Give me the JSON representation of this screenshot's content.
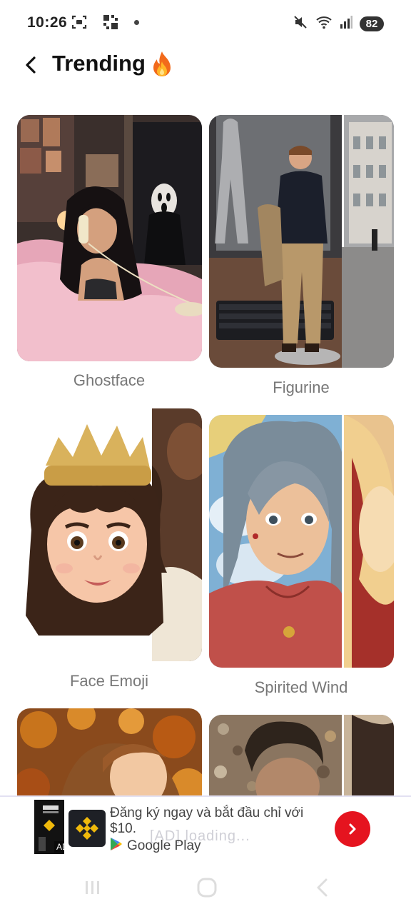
{
  "status_bar": {
    "time": "10:26",
    "battery": "82",
    "icons": [
      "screenshot-icon",
      "app-grid-icon",
      "notification-dot",
      "mute-icon",
      "wifi-icon",
      "signal-icon"
    ]
  },
  "header": {
    "title": "Trending",
    "icon": "fire-icon"
  },
  "cards": [
    {
      "label": "Ghostface"
    },
    {
      "label": "Figurine"
    },
    {
      "label": "Face Emoji"
    },
    {
      "label": "Spirited Wind"
    },
    {
      "label": ""
    },
    {
      "label": ""
    }
  ],
  "ad": {
    "text": "Đăng ký ngay và bắt đầu chỉ với $10.",
    "store": "Google Play",
    "badge": "AD",
    "ghost_text": "[AD]  loading..."
  },
  "nav": {
    "icons": [
      "recents-icon",
      "home-icon",
      "back-icon"
    ]
  },
  "colors": {
    "accent": "#e5141f",
    "label": "#777777",
    "binance": "#f0b90b"
  }
}
